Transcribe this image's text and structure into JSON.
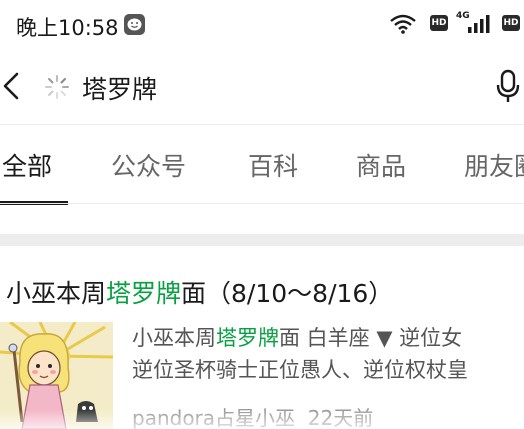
{
  "status_bar": {
    "time": "晚上10:58",
    "app_icon": "wechat-smile-icon",
    "wifi_icon": "wifi-icon",
    "hd_label": "HD",
    "network_type": "4G",
    "signal_icon": "signal-bars-icon"
  },
  "search": {
    "query": "塔罗牌",
    "back_icon": "chevron-left-icon",
    "loading_icon": "spinner-icon",
    "mic_icon": "microphone-icon"
  },
  "tabs": [
    {
      "label": "全部",
      "active": true
    },
    {
      "label": "公众号",
      "active": false
    },
    {
      "label": "百科",
      "active": false
    },
    {
      "label": "商品",
      "active": false
    },
    {
      "label": "朋友圈",
      "active": false
    }
  ],
  "result": {
    "title_prefix": "小巫本周",
    "title_highlight": "塔罗牌",
    "title_suffix": "面（8/10～8/16）",
    "snippet_line1_prefix": "小巫本周",
    "snippet_line1_highlight": "塔罗牌",
    "snippet_line1_suffix": "面 白羊座 ▼ 逆位女",
    "snippet_line2": "逆位圣杯骑士正位愚人、逆位权杖皇",
    "source": "pandora占星小巫",
    "time_ago": "22天前",
    "highlight_color": "#07a141"
  }
}
